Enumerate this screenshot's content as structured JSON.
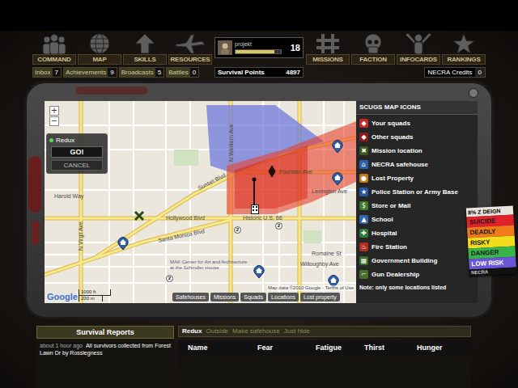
{
  "nav": {
    "left": [
      {
        "label": "COMMAND"
      },
      {
        "label": "MAP"
      },
      {
        "label": "SKILLS"
      },
      {
        "label": "RESOURCES"
      }
    ],
    "right": [
      {
        "label": "MISSIONS"
      },
      {
        "label": "FACTION"
      },
      {
        "label": "INFOCARDS"
      },
      {
        "label": "RANKINGS"
      }
    ]
  },
  "player": {
    "name": "projekt",
    "level": 0.85,
    "number": "18"
  },
  "counters": [
    {
      "label": "Inbox",
      "count": "7"
    },
    {
      "label": "Achievements",
      "count": "9"
    },
    {
      "label": "Broadcasts",
      "count": "5"
    },
    {
      "label": "Battles",
      "count": "0"
    }
  ],
  "survival_points": {
    "label": "Survival Points",
    "value": "4897"
  },
  "credits": {
    "label": "NECRA Credits",
    "value": "0"
  },
  "map": {
    "squad_panel": {
      "squad": "Redux",
      "go": "GO!",
      "cancel": "CANCEL"
    },
    "zoom": [
      "+",
      "−"
    ],
    "zones": [
      {
        "color": "#6f79dc"
      },
      {
        "color": "#e8432f"
      }
    ],
    "streets": [
      {
        "label": "Sunset Blvd"
      },
      {
        "label": "Hollywood Blvd"
      },
      {
        "label": "Santa Monica Blvd"
      },
      {
        "label": "Fountain Ave"
      },
      {
        "label": "Historic U.S. 66"
      },
      {
        "label": "Harold Way"
      },
      {
        "label": "Lexington Ave"
      },
      {
        "label": "Romaine St"
      },
      {
        "label": "Willoughby Ave"
      },
      {
        "label": "N Virgil Ave"
      },
      {
        "label": "N Western Ave"
      },
      {
        "label": "MAK Center for Art and Architecture at the Schindler House"
      }
    ],
    "shields": [
      "2",
      "2",
      "2"
    ],
    "markers": [
      {
        "kind": "safehouse"
      },
      {
        "kind": "safehouse"
      },
      {
        "kind": "safehouse"
      },
      {
        "kind": "safehouse"
      },
      {
        "kind": "safehouse"
      },
      {
        "kind": "mission"
      },
      {
        "kind": "squad"
      },
      {
        "kind": "other_squad"
      }
    ],
    "scale": [
      "1000 ft",
      "200 m"
    ],
    "logo": "Google",
    "attribution": "Map data ©2010 Google - Terms of Use",
    "tabs": [
      {
        "label": "Safehouses"
      },
      {
        "label": "Missions"
      },
      {
        "label": "Squads"
      },
      {
        "label": "Locations"
      },
      {
        "label": "Lost property"
      }
    ]
  },
  "legend": {
    "title": "SCUGS MAP ICONS",
    "items": [
      {
        "label": "Your squads",
        "icon": "◆",
        "color": "#c62828"
      },
      {
        "label": "Other squads",
        "icon": "◆",
        "color": "#8e1b1b"
      },
      {
        "label": "Mission location",
        "icon": "✖",
        "color": "#3d5a1e"
      },
      {
        "label": "NECRA safehouse",
        "icon": "⌂",
        "color": "#2f5fa8"
      },
      {
        "label": "Lost Property",
        "icon": "●",
        "color": "#c77a1a"
      },
      {
        "label": "Police Station or Army Base",
        "icon": "★",
        "color": "#2a55a0"
      },
      {
        "label": "Store or Mall",
        "icon": "$",
        "color": "#3d7a2a"
      },
      {
        "label": "School",
        "icon": "▲",
        "color": "#3566b0"
      },
      {
        "label": "Hospital",
        "icon": "✚",
        "color": "#2f7a35"
      },
      {
        "label": "Fire Station",
        "icon": "♨",
        "color": "#b52a22"
      },
      {
        "label": "Government Building",
        "icon": "▦",
        "color": "#3a6e2a"
      },
      {
        "label": "Gun Dealership",
        "icon": "⌐",
        "color": "#47702c"
      }
    ],
    "note": "Note: only some locations listed"
  },
  "threat": {
    "header": "8% Z DEIGN",
    "levels": [
      {
        "label": "SUICIDE",
        "color": "#e0212b"
      },
      {
        "label": "DEADLY",
        "color": "#f07a1a"
      },
      {
        "label": "RISKY",
        "color": "#f2dc1c"
      },
      {
        "label": "DANGER",
        "color": "#38b54a"
      },
      {
        "label": "LOW RISK",
        "color": "#6a55d6"
      }
    ],
    "footer": "NECRA"
  },
  "reports": {
    "title": "Survival Reports",
    "entries": [
      {
        "time": "about 1 hour ago",
        "text": "All survivors collected from Forest Lawn Dr by Rosslegness"
      }
    ]
  },
  "squad": {
    "tabs": [
      {
        "label": "Redux",
        "selected": true
      },
      {
        "label": "Outside",
        "selected": false
      },
      {
        "label": "Make safehouse",
        "selected": false
      },
      {
        "label": "Just hide",
        "selected": false
      }
    ],
    "columns": [
      "Name",
      "Fear",
      "Fatigue",
      "Thirst",
      "Hunger"
    ]
  }
}
